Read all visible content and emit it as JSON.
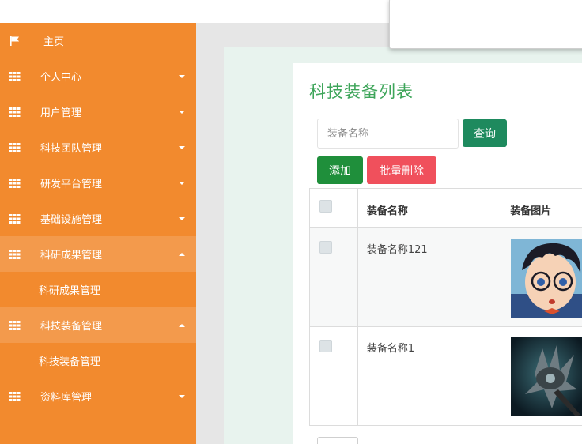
{
  "sidebar": {
    "items": [
      {
        "label": "主页",
        "icon": "flag-icon",
        "caret": "none"
      },
      {
        "label": "个人中心",
        "icon": "grid-icon",
        "caret": "down"
      },
      {
        "label": "用户管理",
        "icon": "grid-icon",
        "caret": "down"
      },
      {
        "label": "科技团队管理",
        "icon": "grid-icon",
        "caret": "down"
      },
      {
        "label": "研发平台管理",
        "icon": "grid-icon",
        "caret": "down"
      },
      {
        "label": "基础设施管理",
        "icon": "grid-icon",
        "caret": "down"
      },
      {
        "label": "科研成果管理",
        "icon": "grid-icon",
        "caret": "up",
        "sub": "科研成果管理"
      },
      {
        "label": "科技装备管理",
        "icon": "grid-icon",
        "caret": "up",
        "sub": "科技装备管理"
      },
      {
        "label": "资料库管理",
        "icon": "grid-icon",
        "caret": "down"
      }
    ]
  },
  "main": {
    "title": "科技装备列表",
    "search": {
      "placeholder": "装备名称",
      "value": ""
    },
    "query_label": "查询",
    "add_label": "添加",
    "batch_delete_label": "批量删除",
    "table": {
      "headers": [
        "装备名称",
        "装备图片"
      ],
      "rows": [
        {
          "name": "装备名称121",
          "image": "cartoon-boy-with-glasses"
        },
        {
          "name": "装备名称1",
          "image": "spiked-mace-weapon"
        }
      ]
    },
    "pager_text": "..."
  },
  "colors": {
    "sidebar": "#f28a2e",
    "sidebar_active": "#f39a4c",
    "title": "#3ea55a",
    "query": "#1e8a5e",
    "add": "#1f8f3b",
    "delete": "#f0505c"
  }
}
